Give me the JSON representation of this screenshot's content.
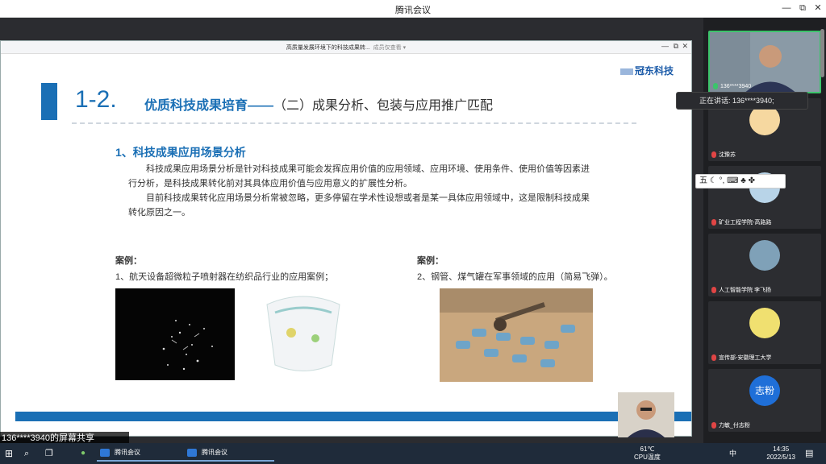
{
  "app": {
    "title": "腾讯会议"
  },
  "share_window": {
    "title": "高质量发展环境下的科技成果转...",
    "view_mode": "成员仅查看 ▾"
  },
  "slide": {
    "logo": "冠东科技",
    "section_number": "1-2.",
    "section_title_bold": "优质科技成果培育——",
    "section_title_rest": "（二）成果分析、包装与应用推广匹配",
    "subheading": "1、科技成果应用场景分析",
    "paragraph1": "科技成果应用场景分析是针对科技成果可能会发挥应用价值的应用领域、应用环境、使用条件、使用价值等因素进行分析，是科技成果转化前对其具体应用价值与应用意义的扩展性分析。",
    "paragraph2": "目前科技成果转化应用场景分析常被忽略，更多停留在学术性设想或者是某一具体应用领域中，这是限制科技成果转化原因之一。",
    "case1_label": "案例：",
    "case1_text": "1、航天设备超微粒子喷射器在纺织品行业的应用案例；",
    "case2_label": "案例：",
    "case2_text": "2、钢管、煤气罐在军事领域的应用（简易飞弹）。"
  },
  "banner": {
    "text": "136****3940的屏幕共享"
  },
  "speaking": {
    "text": "正在讲话: 136****3940;"
  },
  "ime": {
    "text": "五 ☾ °, ⌨ ♣ ✤"
  },
  "participants": [
    {
      "name": "136****3940",
      "mic": "on"
    },
    {
      "name": "沈豫苏",
      "mic": "off"
    },
    {
      "name": "矿业工程学院-高路路",
      "mic": "off"
    },
    {
      "name": "人工智能学院 李飞扬",
      "mic": "off"
    },
    {
      "name": "宣传部-安徽理工大学",
      "mic": "off"
    },
    {
      "name": "力敏_付志粉",
      "mic": "off",
      "avatar_text": "志粉"
    }
  ],
  "taskbar": {
    "apps": [
      "腾讯会议",
      "腾讯会议"
    ],
    "temperature": "61℃",
    "temp_label": "CPU温度",
    "time": "14:35",
    "date": "2022/5/13",
    "ime_label": "中"
  }
}
